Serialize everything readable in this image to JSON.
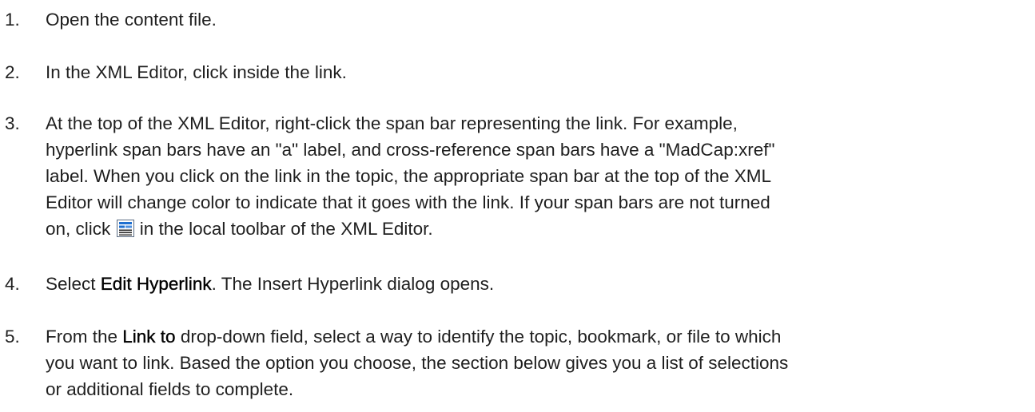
{
  "steps": [
    {
      "number": "1.",
      "text": "Open the content file."
    },
    {
      "number": "2.",
      "text": "In the XML Editor, click inside the link."
    },
    {
      "number": "3.",
      "line1": "At the top of the XML Editor, right-click the span bar representing the link. For example,",
      "line2": "hyperlink span bars have an \"a\" label, and cross-reference span bars have a \"MadCap:xref\"",
      "line3": "label. When you click on the link in the topic, the appropriate span bar at the top of the XML",
      "line4": "Editor will change color to indicate that it goes with the link. If your span bars are not turned",
      "line5_before": "on, click ",
      "line5_icon": "span-bar-toggle-icon",
      "line5_after": " in the local toolbar of the XML Editor."
    },
    {
      "number": "4.",
      "before": "Select ",
      "bold": "Edit Hyperlink",
      "after": ". The Insert Hyperlink dialog opens."
    },
    {
      "number": "5.",
      "before": "From the ",
      "bold": "Link to",
      "after": " drop-down field, select a way to identify the topic, bookmark, or file to which",
      "line2": "you want to link. Based the option you choose, the section below gives you a list of selections",
      "line3": "or additional fields to complete."
    }
  ],
  "colors": {
    "text": "#1f1f1f",
    "icon_border": "#5a6b82",
    "icon_accent": "#1e6fd0"
  }
}
